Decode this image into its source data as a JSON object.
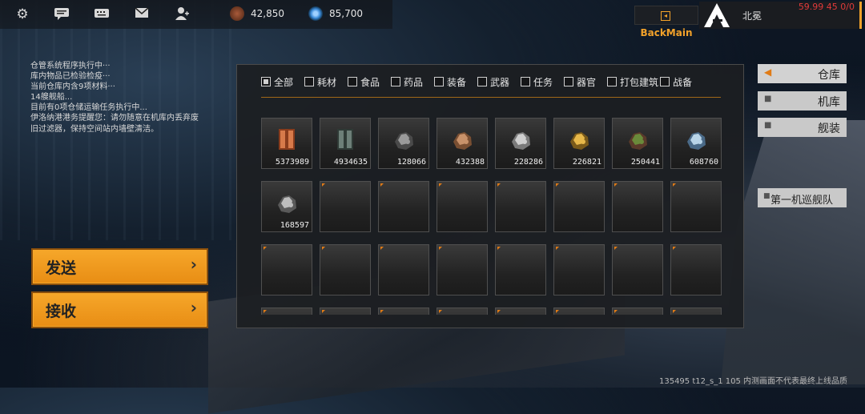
{
  "topbar": {
    "icons": [
      "gear-icon",
      "chat-icon",
      "keyboard-icon",
      "mail-icon",
      "friends-icon"
    ],
    "resources": [
      {
        "icon": "credits-icon",
        "value": "42,850",
        "color": "#a85a3a"
      },
      {
        "icon": "crystal-icon",
        "value": "85,700",
        "color": "#3a8ad8"
      }
    ]
  },
  "backmain_label": "BackMain",
  "player": {
    "name": "北冕",
    "fps": "59.99 45 0/0"
  },
  "log_lines": [
    "仓管系统程序执行中···",
    "库内物品已检验检疫···",
    "当前仓库内含9项材料···",
    "14艘舰船...",
    "目前有0项仓储运输任务执行中...",
    "伊洛纳港港务提醒您：请勿随意在机库内丢弃废",
    "旧过滤器，保持空间站内墙壁清洁。"
  ],
  "actions": {
    "send": "发送",
    "receive": "接收"
  },
  "filters": [
    "全部",
    "耗材",
    "食品",
    "药品",
    "装备",
    "武器",
    "任务",
    "器官",
    "打包建筑",
    "战备"
  ],
  "items": [
    {
      "icon": "copper-ingot-icon",
      "qty": "5373989",
      "c1": "#d77a4a",
      "c2": "#8a3c1c"
    },
    {
      "icon": "alloy-ingot-icon",
      "qty": "4934635",
      "c1": "#6d7f78",
      "c2": "#2f3a36"
    },
    {
      "icon": "iron-ore-icon",
      "qty": "128066",
      "c1": "#9a9a9a",
      "c2": "#4a4a4a"
    },
    {
      "icon": "copper-ore-icon",
      "qty": "432388",
      "c1": "#c9926a",
      "c2": "#7a4f32"
    },
    {
      "icon": "silicon-ore-icon",
      "qty": "228286",
      "c1": "#cfcfcf",
      "c2": "#7a7a7a"
    },
    {
      "icon": "gold-crystal-icon",
      "qty": "226821",
      "c1": "#e7b84a",
      "c2": "#7a5a1a"
    },
    {
      "icon": "organic-ore-icon",
      "qty": "250441",
      "c1": "#6a8a3a",
      "c2": "#5a3a2a"
    },
    {
      "icon": "ice-crystal-icon",
      "qty": "608760",
      "c1": "#b8d4e8",
      "c2": "#4a6a88"
    },
    {
      "icon": "titanium-ore-icon",
      "qty": "168597",
      "c1": "#bdbdbd",
      "c2": "#5a5a5a"
    }
  ],
  "tabs": [
    "仓库",
    "机库",
    "舰装"
  ],
  "fleet_label": "第一机巡舰队",
  "footer": "135495 t12_s_1 105  内测画面不代表最终上线品质",
  "accent_color": "#f3a22a"
}
